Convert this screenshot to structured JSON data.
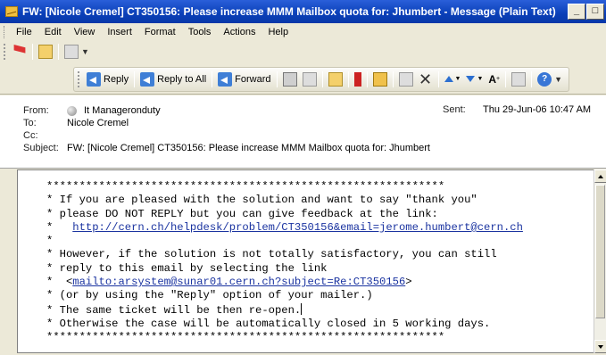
{
  "window": {
    "title": "FW: [Nicole Cremel] CT350156: Please increase MMM Mailbox quota for: Jhumbert - Message (Plain Text)",
    "minimize": "_",
    "restore": "□"
  },
  "menu": [
    "File",
    "Edit",
    "View",
    "Insert",
    "Format",
    "Tools",
    "Actions",
    "Help"
  ],
  "toolbar": {
    "reply": "Reply",
    "reply_all": "Reply to All",
    "forward": "Forward",
    "font_size_icon": "A",
    "help_icon": "?"
  },
  "header": {
    "from_label": "From:",
    "from_value": "It Manageronduty",
    "to_label": "To:",
    "to_value": "Nicole Cremel",
    "cc_label": "Cc:",
    "cc_value": "",
    "subject_label": "Subject:",
    "subject_value": "FW: [Nicole Cremel] CT350156: Please increase MMM Mailbox quota for: Jhumbert",
    "sent_label": "Sent:",
    "sent_value": "Thu 29-Jun-06 10:47 AM"
  },
  "body": {
    "stars": "*************************************************************",
    "line1": "* If you are pleased with the solution and want to say \"thank you\"",
    "line2": "* please DO NOT REPLY but you can give feedback at the link:",
    "line3_prefix": "*   ",
    "link1": "http://cern.ch/helpdesk/problem/CT350156&email=jerome.humbert@cern.ch",
    "line4": "*",
    "line5": "* However, if the solution is not totally satisfactory, you can still",
    "line6": "* reply to this email by selecting the link",
    "line7_prefix": "*  <",
    "link2": "mailto:arsystem@sunar01.cern.ch?subject=Re:CT350156",
    "line7_suffix": ">",
    "line8": "* (or by using the \"Reply\" option of your mailer.)",
    "line9": "* The same ticket will be then re-open.",
    "line10": "* Otherwise the case will be automatically closed in 5 working days.",
    "stars2": "*************************************************************"
  }
}
